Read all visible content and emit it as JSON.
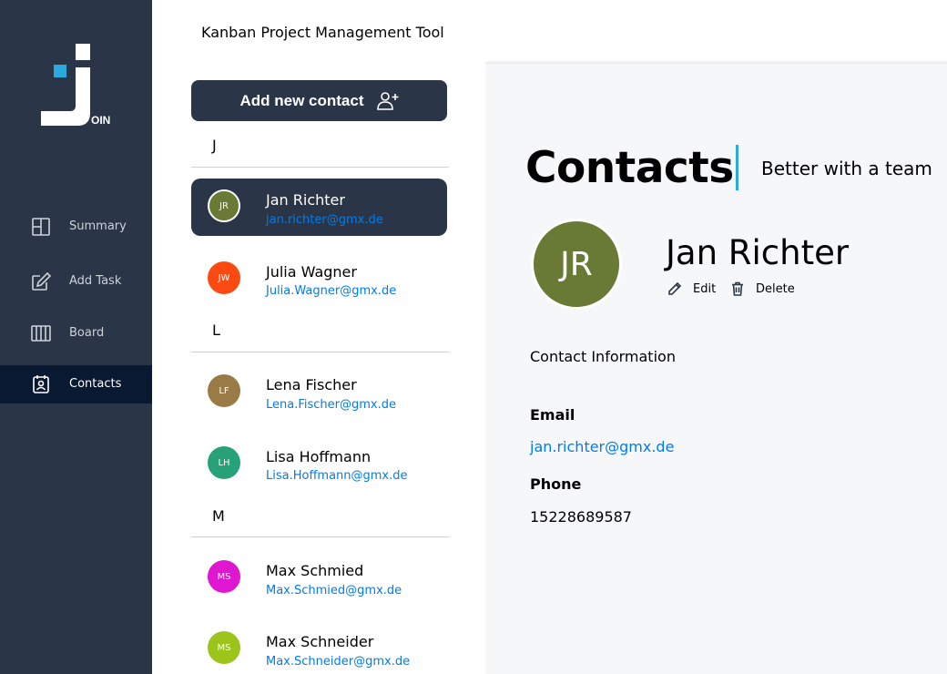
{
  "app": {
    "title": "Kanban Project Management Tool",
    "logo_text": "OIN"
  },
  "nav": [
    {
      "label": "Summary",
      "icon": "summary-icon"
    },
    {
      "label": "Add Task",
      "icon": "edit-square-icon"
    },
    {
      "label": "Board",
      "icon": "board-icon"
    },
    {
      "label": "Contacts",
      "icon": "contacts-icon",
      "active": true
    }
  ],
  "contact_list": {
    "add_button_label": "Add new contact",
    "groups": [
      {
        "letter": "J",
        "contacts": [
          {
            "initials": "JR",
            "name": "Jan Richter",
            "email": "jan.richter@gmx.de",
            "color": "#697a34",
            "selected": true
          },
          {
            "initials": "JW",
            "name": "Julia Wagner",
            "email": "Julia.Wagner@gmx.de",
            "color": "#fc4a12"
          }
        ]
      },
      {
        "letter": "L",
        "contacts": [
          {
            "initials": "LF",
            "name": "Lena Fischer",
            "email": "Lena.Fischer@gmx.de",
            "color": "#9a7b46"
          },
          {
            "initials": "LH",
            "name": "Lisa Hoffmann",
            "email": "Lisa.Hoffmann@gmx.de",
            "color": "#27a278"
          }
        ]
      },
      {
        "letter": "M",
        "contacts": [
          {
            "initials": "MS",
            "name": "Max Schmied",
            "email": "Max.Schmied@gmx.de",
            "color": "#e017d0"
          },
          {
            "initials": "MS",
            "name": "Max Schneider",
            "email": "Max.Schneider@gmx.de",
            "color": "#9cc41a"
          }
        ]
      }
    ]
  },
  "detail": {
    "heading": "Contacts",
    "subheading": "Better with a team",
    "initials": "JR",
    "name": "Jan Richter",
    "edit_label": "Edit",
    "delete_label": "Delete",
    "info_heading": "Contact Information",
    "email_label": "Email",
    "email": "jan.richter@gmx.de",
    "phone_label": "Phone",
    "phone": "15228689587"
  },
  "colors": {
    "sidebar": "#2a3647",
    "sidebar_active": "#091931",
    "accent_blue": "#29abe2",
    "link": "#007cee",
    "panel_bg": "#f6f7f8"
  }
}
